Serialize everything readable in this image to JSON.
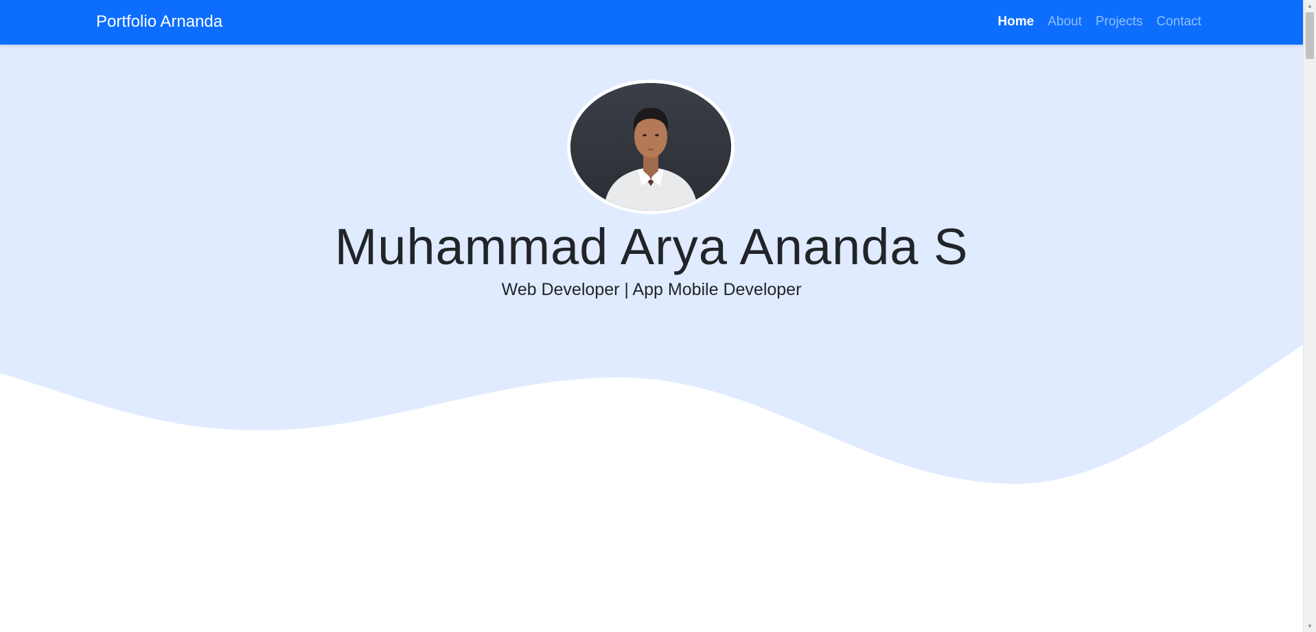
{
  "navbar": {
    "brand": "Portfolio Arnanda",
    "links": [
      {
        "label": "Home",
        "active": true
      },
      {
        "label": "About",
        "active": false
      },
      {
        "label": "Projects",
        "active": false
      },
      {
        "label": "Contact",
        "active": false
      }
    ]
  },
  "hero": {
    "name": "Muhammad Arya Ananda S",
    "subtitle": "Web Developer | App Mobile Developer"
  },
  "colors": {
    "navbar": "#0d6efd",
    "hero_background": "#e0ebff",
    "text": "#212529"
  },
  "icons": {
    "scroll_up": "scroll-up-arrow-icon",
    "scroll_down": "scroll-down-arrow-icon"
  }
}
